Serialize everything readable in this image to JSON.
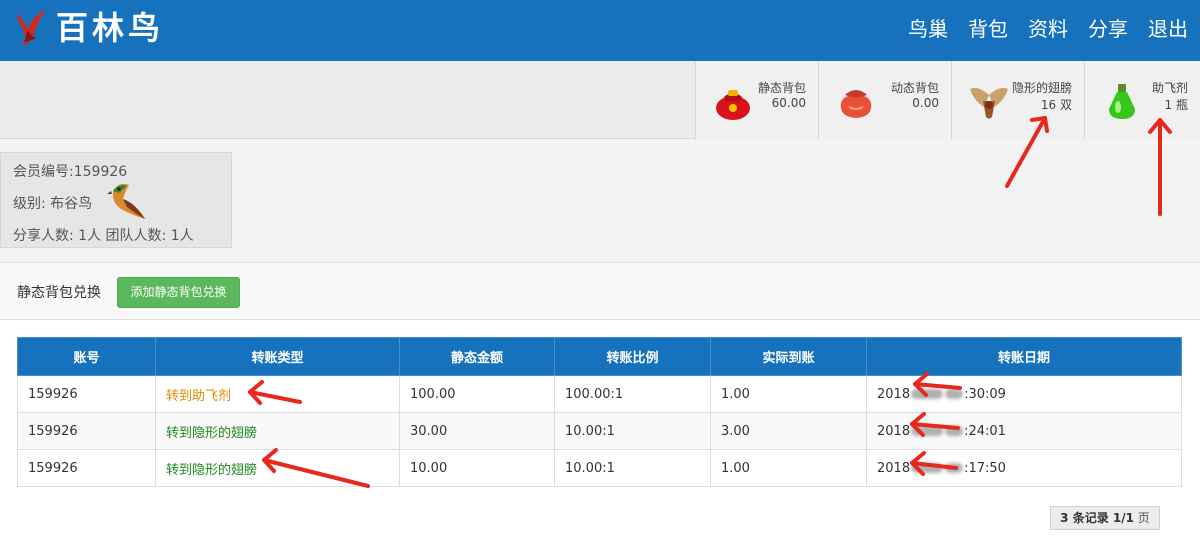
{
  "header": {
    "logo_text": "百林鸟",
    "nav": [
      "鸟巢",
      "背包",
      "资料",
      "分享",
      "退出"
    ]
  },
  "stats": [
    {
      "label": "静态背包",
      "value": "60.00",
      "icon": "red-bag-icon"
    },
    {
      "label": "动态背包",
      "value": "0.00",
      "icon": "red-pouch-icon"
    },
    {
      "label": "隐形的翅膀",
      "value": "16 双",
      "icon": "wings-icon"
    },
    {
      "label": "助飞剂",
      "value": "1 瓶",
      "icon": "green-potion-icon"
    }
  ],
  "member": {
    "id_line": "会员编号:159926",
    "level_line": "级别:  布谷鸟",
    "counts_line": "分享人数:  1人    团队人数:  1人"
  },
  "panel": {
    "title": "静态背包兑换",
    "add_button": "添加静态背包兑换"
  },
  "table": {
    "headers": [
      "账号",
      "转账类型",
      "静态金额",
      "转账比例",
      "实际到账",
      "转账日期"
    ],
    "rows": [
      {
        "account": "159926",
        "type": "转到助飞剂",
        "amount": "100.00",
        "ratio": "100.00:1",
        "actual": "1.00",
        "date_prefix": "2018",
        "date_suffix": ":30:09"
      },
      {
        "account": "159926",
        "type": "转到隐形的翅膀",
        "amount": "30.00",
        "ratio": "10.00:1",
        "actual": "3.00",
        "date_prefix": "2018",
        "date_suffix": ":24:01"
      },
      {
        "account": "159926",
        "type": "转到隐形的翅膀",
        "amount": "10.00",
        "ratio": "10.00:1",
        "actual": "1.00",
        "date_prefix": "2018",
        "date_suffix": ":17:50"
      }
    ]
  },
  "pager": {
    "count": "3 条记录 1/1",
    "unit": "页"
  },
  "colors": {
    "brand_blue": "#1772bd",
    "button_green": "#5cb85c",
    "type_orange": "#e08a00",
    "type_green": "#1b8a1b",
    "annotation_red": "#e8271d"
  }
}
